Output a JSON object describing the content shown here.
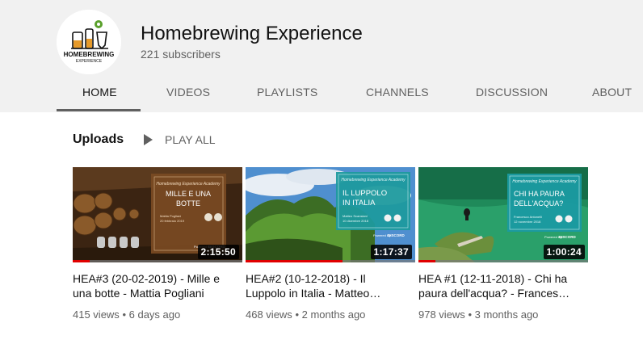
{
  "channel": {
    "name": "Homebrewing Experience",
    "subscribers": "221 subscribers",
    "logo_text": "HOMEBREWING",
    "logo_subtext": "EXPERIENCE"
  },
  "tabs": [
    {
      "label": "HOME",
      "active": true
    },
    {
      "label": "VIDEOS",
      "active": false
    },
    {
      "label": "PLAYLISTS",
      "active": false
    },
    {
      "label": "CHANNELS",
      "active": false
    },
    {
      "label": "DISCUSSION",
      "active": false
    },
    {
      "label": "ABOUT",
      "active": false
    }
  ],
  "section": {
    "title": "Uploads",
    "play_all": "PLAY ALL"
  },
  "videos": [
    {
      "title": "HEA#3 (20-02-2019) - Mille e una botte - Mattia Pogliani",
      "title_line1": "HEA#3 (20-02-2019) - Mille e",
      "title_line2": "una botte - Mattia Pogliani",
      "views": "415 views",
      "age": "6 days ago",
      "duration": "2:15:50",
      "watched_fraction": 0.1,
      "thumb_heading": "Homebrewing Experience Academy",
      "thumb_title_1": "MILLE E UNA",
      "thumb_title_2": "BOTTE",
      "thumb_speaker": "Mattia Pogliani",
      "thumb_date": "20 febbraio 2019",
      "thumb_powered": "Powered By",
      "thumb_discord": "DISCORD"
    },
    {
      "title": "HEA#2 (10-12-2018) - Il Luppolo in Italia - Matteo…",
      "title_line1": "HEA#2 (10-12-2018) - Il",
      "title_line2": "Luppolo in Italia - Matteo…",
      "views": "468 views",
      "age": "2 months ago",
      "duration": "1:17:37",
      "watched_fraction": 0.57,
      "thumb_heading": "Homebrewing Experience Academy",
      "thumb_title_1": "IL LUPPOLO",
      "thumb_title_2": "IN ITALIA",
      "thumb_speaker": "Matteo Scansiani",
      "thumb_date": "10 dicembre 2018",
      "thumb_powered": "Powered By",
      "thumb_discord": "DISCORD"
    },
    {
      "title": "HEA #1 (12-11-2018) - Chi ha paura dell'acqua? - Frances…",
      "title_line1": "HEA #1 (12-11-2018) - Chi ha",
      "title_line2": "paura dell'acqua? - Frances…",
      "views": "978 views",
      "age": "3 months ago",
      "duration": "1:00:24",
      "watched_fraction": 0.1,
      "thumb_heading": "Homebrewing Experience Academy",
      "thumb_title_1": "CHI HA PAURA",
      "thumb_title_2": "DELL'ACQUA?",
      "thumb_speaker": "Francesco Antonelli",
      "thumb_date": "12 novembre 2018",
      "thumb_powered": "Powered By",
      "thumb_discord": "DISCORD"
    }
  ],
  "meta_separator": "•",
  "colors": {
    "header_bg": "#f1f1f1",
    "progress_red": "#e00000",
    "card_teal": "#1e9a9e",
    "card_brown": "#7a4a22"
  }
}
